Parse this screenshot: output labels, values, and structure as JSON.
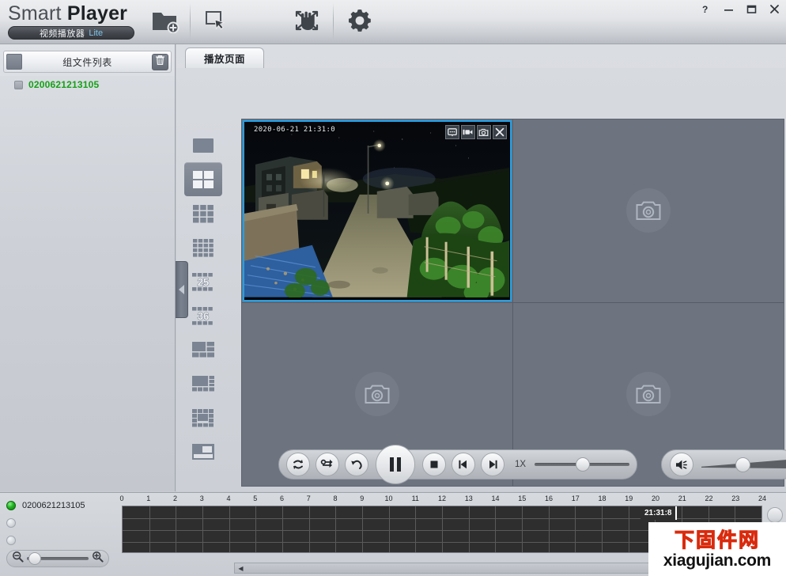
{
  "app": {
    "brand_first": "Smart",
    "brand_second": "Player",
    "brand_cn": "视频播放器",
    "brand_edition": "Lite"
  },
  "titlebar": {
    "buttons": [
      {
        "name": "open-folder-button",
        "icon": "folder-add-icon"
      },
      {
        "name": "select-tool-button",
        "icon": "pointer-select-icon"
      },
      {
        "name": "pan-tool-button",
        "icon": "hand-pan-icon"
      },
      {
        "name": "fullscreen-button",
        "icon": "fullscreen-icon"
      },
      {
        "name": "settings-button",
        "icon": "gear-icon"
      }
    ],
    "window_controls": [
      {
        "name": "help-button",
        "glyph": "?"
      },
      {
        "name": "minimize-button",
        "glyph": "–"
      },
      {
        "name": "maximize-button",
        "glyph": "▭"
      },
      {
        "name": "close-button",
        "glyph": "✕"
      }
    ]
  },
  "sidebar": {
    "header_title": "组文件列表",
    "select_all_name": "select-all-checkbox",
    "delete_name": "delete-group-button",
    "items": [
      {
        "label": "0200621213105",
        "checked": false,
        "color": "#16a116"
      }
    ]
  },
  "main": {
    "tabs": [
      {
        "label": "播放页面",
        "active": true
      }
    ],
    "layout_rail": [
      {
        "name": "layout-1",
        "type": "single",
        "active": false
      },
      {
        "name": "layout-4",
        "type": "grid2",
        "active": true
      },
      {
        "name": "layout-9",
        "type": "grid3",
        "active": false
      },
      {
        "name": "layout-16",
        "type": "grid4",
        "active": false
      },
      {
        "name": "layout-25",
        "type": "num",
        "label": "25",
        "active": false
      },
      {
        "name": "layout-36",
        "type": "num",
        "label": "36",
        "active": false
      },
      {
        "name": "layout-custom-a",
        "type": "cust1",
        "active": false
      },
      {
        "name": "layout-custom-b",
        "type": "cust2",
        "active": false
      },
      {
        "name": "layout-custom-c",
        "type": "cust3",
        "active": false
      },
      {
        "name": "layout-custom-d",
        "type": "cust4",
        "active": false
      }
    ],
    "grid": {
      "rows": 2,
      "cols": 2,
      "selected_cell": 0,
      "selection_color": "#1ea2ec",
      "cells": [
        {
          "name": "video-cell-1",
          "has_video": true,
          "timestamp": "2020-06-21 21:31:0",
          "tools": [
            {
              "name": "talk-icon"
            },
            {
              "name": "record-video-icon"
            },
            {
              "name": "snapshot-camera-icon"
            },
            {
              "name": "close-stream-icon"
            }
          ]
        },
        {
          "name": "video-cell-2",
          "has_video": false,
          "placeholder_icon": "camera-icon"
        },
        {
          "name": "video-cell-3",
          "has_video": false,
          "placeholder_icon": "camera-icon"
        },
        {
          "name": "video-cell-4",
          "has_video": false,
          "placeholder_icon": "camera-icon"
        }
      ]
    }
  },
  "transport": {
    "buttons": [
      {
        "name": "loop-button",
        "icon": "loop-icon"
      },
      {
        "name": "sync-shuffle-button",
        "icon": "shuffle-icon"
      },
      {
        "name": "step-back-button",
        "icon": "undo-arrow-icon"
      },
      {
        "name": "pause-button",
        "icon": "pause-icon",
        "big": true
      },
      {
        "name": "stop-button",
        "icon": "stop-icon"
      },
      {
        "name": "prev-frame-button",
        "icon": "frame-back-icon"
      },
      {
        "name": "next-frame-button",
        "icon": "frame-forward-icon"
      }
    ],
    "speed_label": "1X",
    "speed_value": 50,
    "volume_value": 45,
    "volume_icon": "speaker-icon"
  },
  "timeline": {
    "channels": [
      {
        "label": "0200621213105",
        "active": true
      },
      {
        "label": "",
        "active": false
      },
      {
        "label": "",
        "active": false
      },
      {
        "label": "",
        "active": false
      }
    ],
    "zoom_out_icon": "zoom-out-icon",
    "zoom_in_icon": "zoom-in-icon",
    "zoom_value": 4,
    "hours": [
      "0",
      "1",
      "2",
      "3",
      "4",
      "5",
      "6",
      "7",
      "8",
      "9",
      "10",
      "11",
      "12",
      "13",
      "14",
      "15",
      "16",
      "17",
      "18",
      "19",
      "20",
      "21",
      "22",
      "23",
      "24"
    ],
    "cursor_time": "21:31:8",
    "cursor_hour": 21,
    "scroll_left_icon": "arrow-left-icon"
  },
  "watermark": {
    "cn": "下固件网",
    "en": "xiagujian.com"
  }
}
